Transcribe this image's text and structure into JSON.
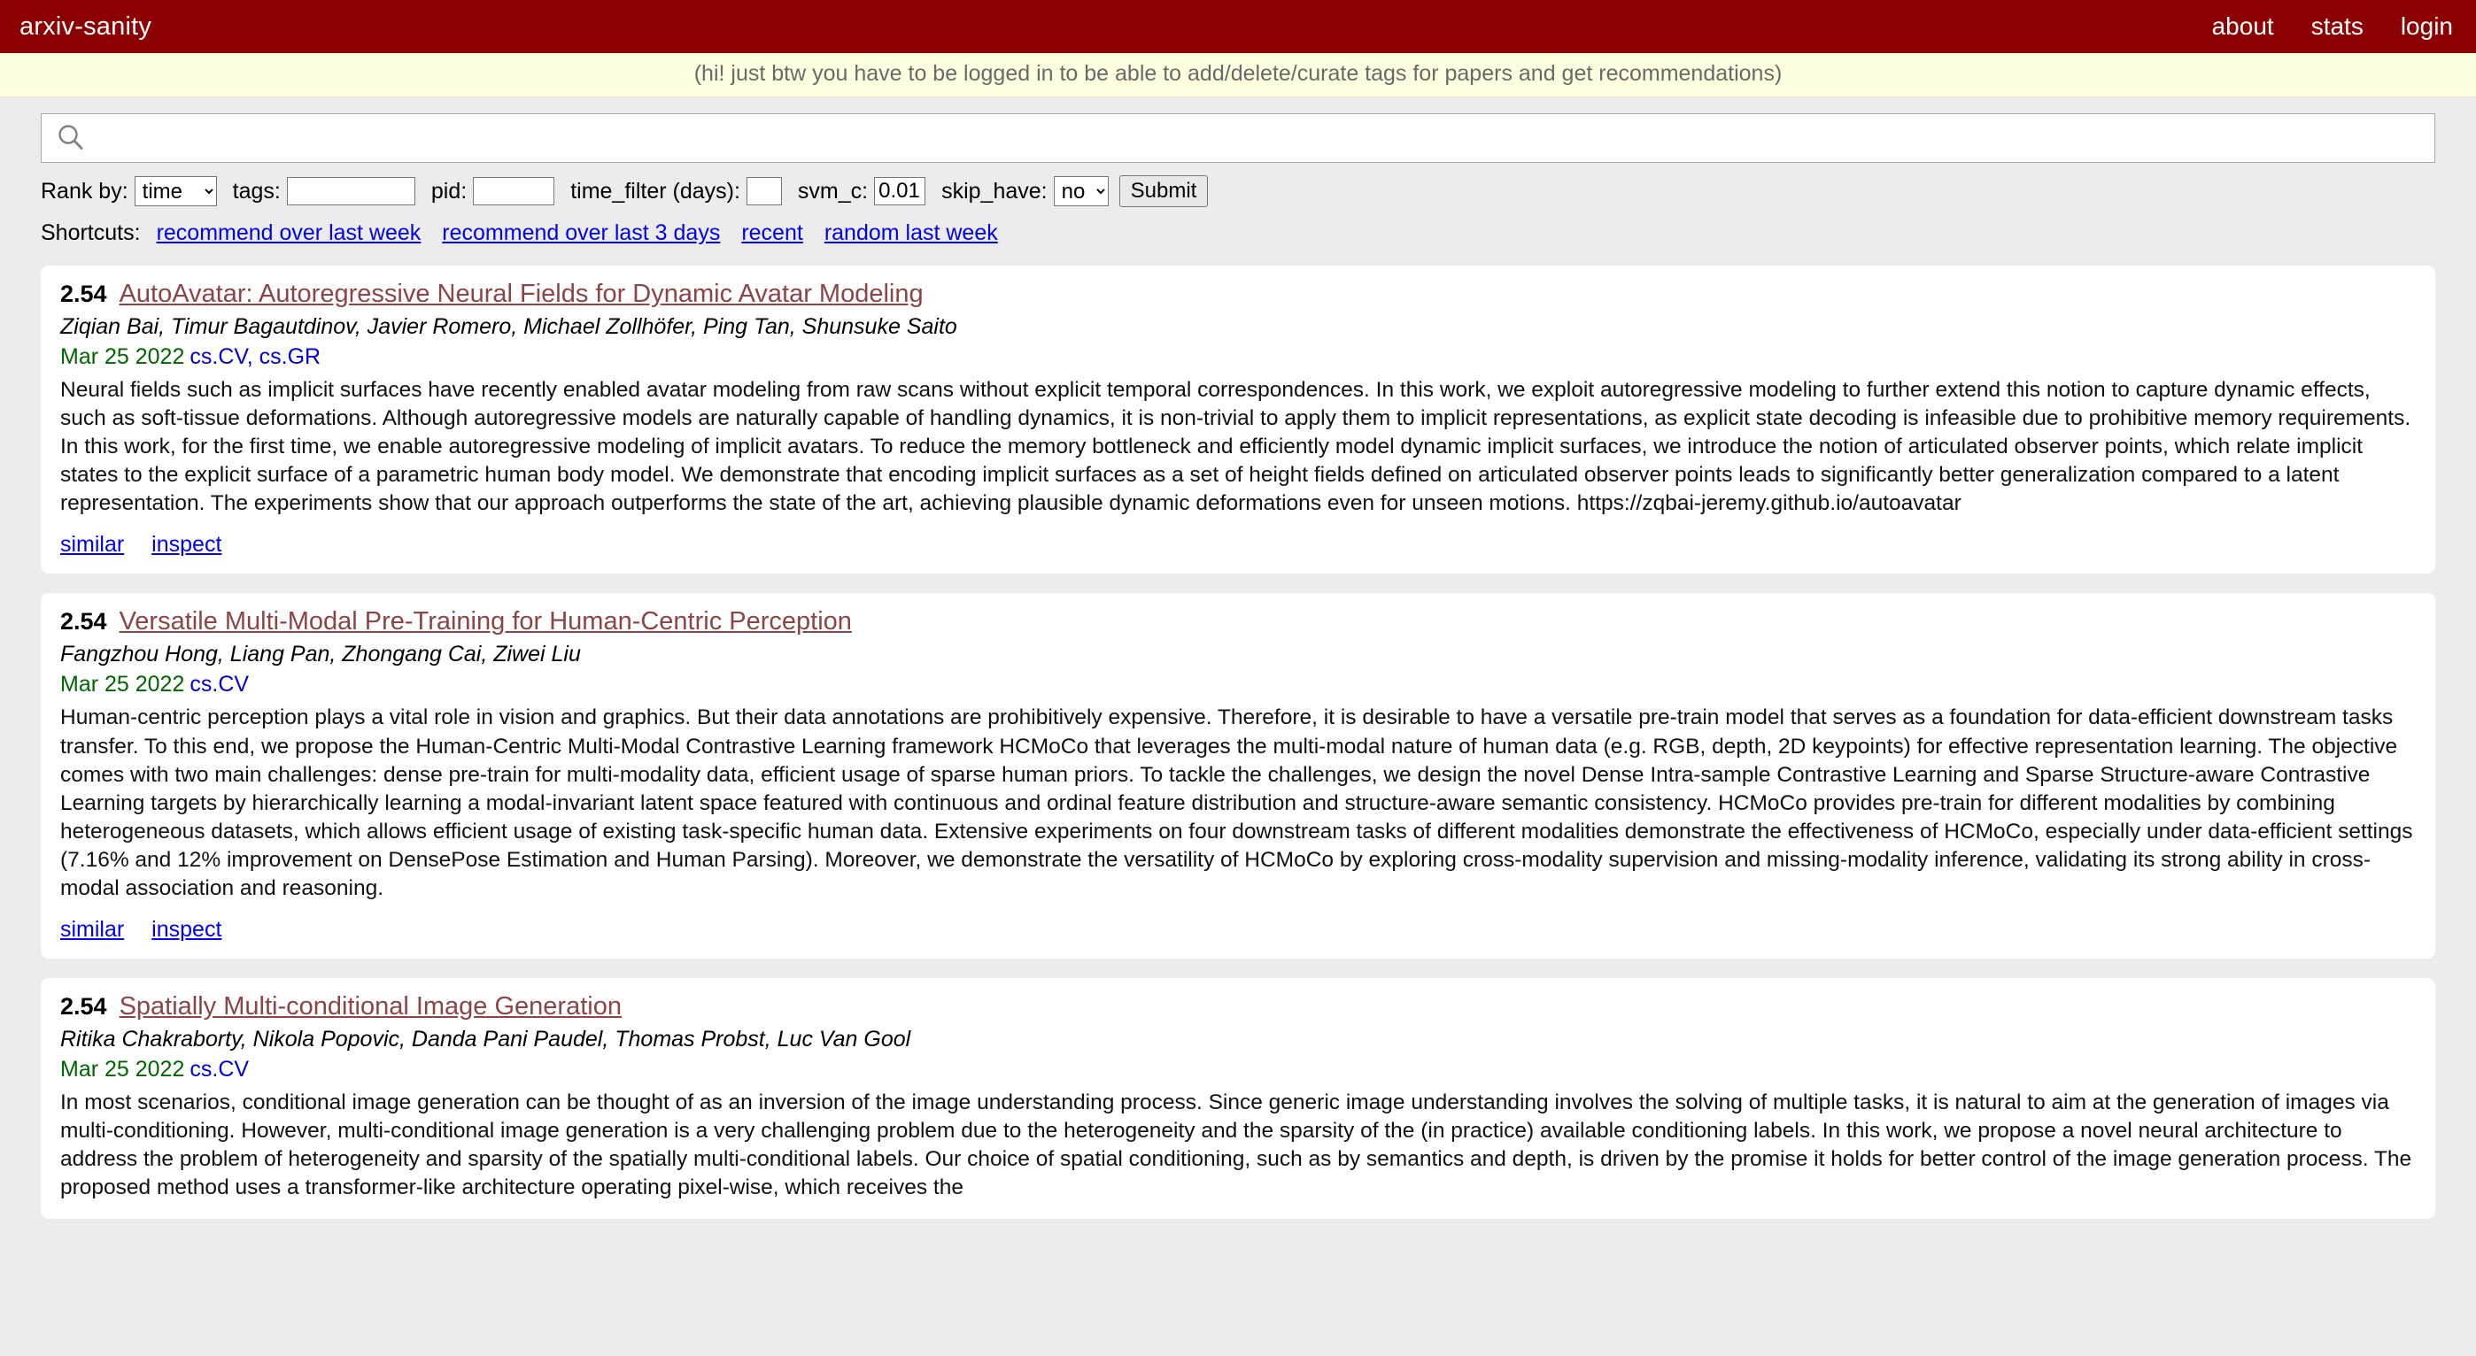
{
  "header": {
    "brand": "arxiv-sanity",
    "nav": [
      {
        "label": "about"
      },
      {
        "label": "stats"
      },
      {
        "label": "login"
      }
    ]
  },
  "banner": {
    "message": "(hi! just btw you have to be logged in to be able to add/delete/curate tags for papers and get recommendations)"
  },
  "search": {
    "icon": "search-icon",
    "value": "",
    "placeholder": ""
  },
  "filters": {
    "rank_label": "Rank by:",
    "rank_value": "time",
    "rank_options": [
      "time"
    ],
    "tags_label": "tags:",
    "tags_value": "",
    "pid_label": "pid:",
    "pid_value": "",
    "time_filter_label": "time_filter (days):",
    "time_filter_value": "",
    "svm_c_label": "svm_c:",
    "svm_c_value": "0.01",
    "skip_have_label": "skip_have:",
    "skip_have_value": "no",
    "skip_have_options": [
      "no"
    ],
    "submit_label": "Submit"
  },
  "shortcuts": {
    "label": "Shortcuts:",
    "links": [
      {
        "label": "recommend over last week"
      },
      {
        "label": "recommend over last 3 days"
      },
      {
        "label": "recent"
      },
      {
        "label": "random last week"
      }
    ]
  },
  "papers": [
    {
      "score": "2.54",
      "title": "AutoAvatar: Autoregressive Neural Fields for Dynamic Avatar Modeling",
      "authors": "Ziqian Bai, Timur Bagautdinov, Javier Romero, Michael Zollhöfer, Ping Tan, Shunsuke Saito",
      "date": "Mar 25 2022",
      "categories": "cs.CV, cs.GR",
      "abstract": "Neural fields such as implicit surfaces have recently enabled avatar modeling from raw scans without explicit temporal correspondences. In this work, we exploit autoregressive modeling to further extend this notion to capture dynamic effects, such as soft-tissue deformations. Although autoregressive models are naturally capable of handling dynamics, it is non-trivial to apply them to implicit representations, as explicit state decoding is infeasible due to prohibitive memory requirements. In this work, for the first time, we enable autoregressive modeling of implicit avatars. To reduce the memory bottleneck and efficiently model dynamic implicit surfaces, we introduce the notion of articulated observer points, which relate implicit states to the explicit surface of a parametric human body model. We demonstrate that encoding implicit surfaces as a set of height fields defined on articulated observer points leads to significantly better generalization compared to a latent representation. The experiments show that our approach outperforms the state of the art, achieving plausible dynamic deformations even for unseen motions. https://zqbai-jeremy.github.io/autoavatar",
      "links": [
        {
          "label": "similar"
        },
        {
          "label": "inspect"
        }
      ]
    },
    {
      "score": "2.54",
      "title": "Versatile Multi-Modal Pre-Training for Human-Centric Perception",
      "authors": "Fangzhou Hong, Liang Pan, Zhongang Cai, Ziwei Liu",
      "date": "Mar 25 2022",
      "categories": "cs.CV",
      "abstract": "Human-centric perception plays a vital role in vision and graphics. But their data annotations are prohibitively expensive. Therefore, it is desirable to have a versatile pre-train model that serves as a foundation for data-efficient downstream tasks transfer. To this end, we propose the Human-Centric Multi-Modal Contrastive Learning framework HCMoCo that leverages the multi-modal nature of human data (e.g. RGB, depth, 2D keypoints) for effective representation learning. The objective comes with two main challenges: dense pre-train for multi-modality data, efficient usage of sparse human priors. To tackle the challenges, we design the novel Dense Intra-sample Contrastive Learning and Sparse Structure-aware Contrastive Learning targets by hierarchically learning a modal-invariant latent space featured with continuous and ordinal feature distribution and structure-aware semantic consistency. HCMoCo provides pre-train for different modalities by combining heterogeneous datasets, which allows efficient usage of existing task-specific human data. Extensive experiments on four downstream tasks of different modalities demonstrate the effectiveness of HCMoCo, especially under data-efficient settings (7.16% and 12% improvement on DensePose Estimation and Human Parsing). Moreover, we demonstrate the versatility of HCMoCo by exploring cross-modality supervision and missing-modality inference, validating its strong ability in cross-modal association and reasoning.",
      "links": [
        {
          "label": "similar"
        },
        {
          "label": "inspect"
        }
      ]
    },
    {
      "score": "2.54",
      "title": "Spatially Multi-conditional Image Generation",
      "authors": "Ritika Chakraborty, Nikola Popovic, Danda Pani Paudel, Thomas Probst, Luc Van Gool",
      "date": "Mar 25 2022",
      "categories": "cs.CV",
      "abstract": "In most scenarios, conditional image generation can be thought of as an inversion of the image understanding process. Since generic image understanding involves the solving of multiple tasks, it is natural to aim at the generation of images via multi-conditioning. However, multi-conditional image generation is a very challenging problem due to the heterogeneity and the sparsity of the (in practice) available conditioning labels. In this work, we propose a novel neural architecture to address the problem of heterogeneity and sparsity of the spatially multi-conditional labels. Our choice of spatial conditioning, such as by semantics and depth, is driven by the promise it holds for better control of the image generation process. The proposed method uses a transformer-like architecture operating pixel-wise, which receives the",
      "links": []
    }
  ],
  "colors": {
    "header_bg": "#8b0000",
    "banner_bg": "#ffffe0",
    "page_bg": "#ececec",
    "title_link": "#8b4545",
    "link_blue": "#0000ee",
    "date_green": "#006400",
    "category_blue": "#0000cd"
  }
}
